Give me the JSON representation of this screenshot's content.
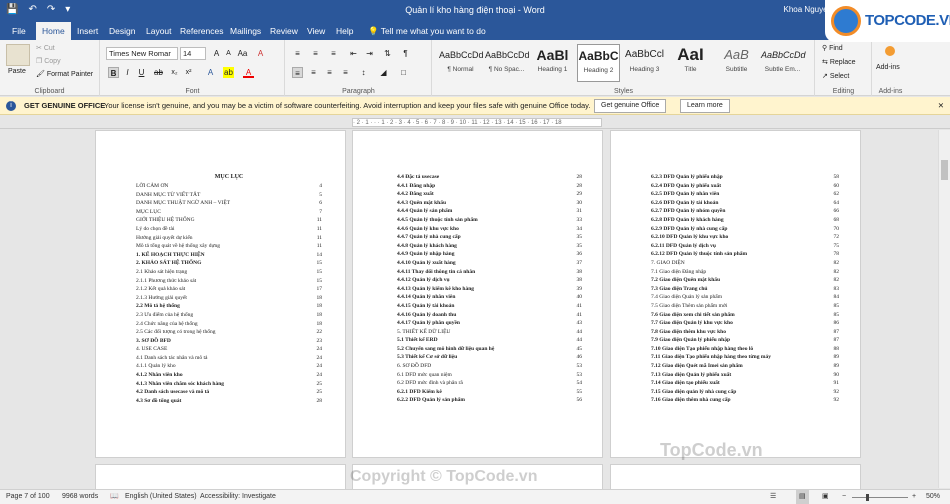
{
  "window": {
    "title": "Quản lí kho hàng điện thoại  -  Word",
    "user": "Khoa Nguyen"
  },
  "qat": {
    "save_icon": "save-icon",
    "undo_icon": "undo-icon",
    "redo_icon": "redo-icon"
  },
  "tabs": [
    "File",
    "Home",
    "Insert",
    "Design",
    "Layout",
    "References",
    "Mailings",
    "Review",
    "View",
    "Help"
  ],
  "tell_me": "Tell me what you want to do",
  "ribbon": {
    "clipboard": {
      "paste": "Paste",
      "cut": "Cut",
      "copy": "Copy",
      "format_painter": "Format Painter",
      "label": "Clipboard"
    },
    "font": {
      "name": "Times New Romar",
      "size": "14",
      "label": "Font"
    },
    "paragraph": {
      "label": "Paragraph"
    },
    "styles": {
      "label": "Styles",
      "items": [
        {
          "preview": "AaBbCcDd",
          "name": "¶ Normal"
        },
        {
          "preview": "AaBbCcDd",
          "name": "¶ No Spac..."
        },
        {
          "preview": "AaBl",
          "name": "Heading 1"
        },
        {
          "preview": "AaBbC",
          "name": "Heading 2"
        },
        {
          "preview": "AaBbCcl",
          "name": "Heading 3"
        },
        {
          "preview": "AaI",
          "name": "Title"
        },
        {
          "preview": "AaB",
          "name": "Subtitle"
        },
        {
          "preview": "AaBbCcDd",
          "name": "Subtle Em..."
        }
      ]
    },
    "editing": {
      "find": "Find",
      "replace": "Replace",
      "select": "Select",
      "label": "Editing"
    },
    "addins": {
      "addins": "Add-ins",
      "label": "Add-ins"
    }
  },
  "notice": {
    "title": "GET GENUINE OFFICE",
    "message": "Your license isn't genuine, and you may be a victim of software counterfeiting. Avoid interruption and keep your files safe with genuine Office today.",
    "btn_genuine": "Get genuine Office",
    "btn_learn": "Learn more"
  },
  "ruler_text": "· 2 · 1 · · · 1 · 2 · 3 · 4 · 5 · 6 · 7 · 8 · 9 · 10 · 11 · 12 · 13 · 14 · 15 · 16 · 17 · 18",
  "page1": {
    "heading": "MỤC LỤC",
    "rows": [
      {
        "t": "LỜI CẢM ƠN",
        "p": "4",
        "b": false
      },
      {
        "t": "DANH MỤC TỪ VIẾT TẮT",
        "p": "5",
        "b": false
      },
      {
        "t": "DANH MỤC THUẬT NGỮ ANH – VIỆT",
        "p": "6",
        "b": false
      },
      {
        "t": "MỤC LỤC",
        "p": "7",
        "b": false
      },
      {
        "t": "GIỚI THIỆU HỆ THỐNG",
        "p": "11",
        "b": false
      },
      {
        "t": "   Lý do chọn đề tài",
        "p": "11",
        "b": false
      },
      {
        "t": "   Hướng giải quyết dự kiến",
        "p": "11",
        "b": false
      },
      {
        "t": "   Mô tả tổng quát về hệ thống xây dựng",
        "p": "11",
        "b": false
      },
      {
        "t": "1.   KẾ HOẠCH THỰC HIỆN",
        "p": "14",
        "b": true
      },
      {
        "t": "2.   KHẢO SÁT HỆ THỐNG",
        "p": "15",
        "b": true
      },
      {
        "t": "   2.1   Khảo sát hiện trạng",
        "p": "15",
        "b": false
      },
      {
        "t": "      2.1.1 Phương thức khảo sát",
        "p": "15",
        "b": false
      },
      {
        "t": "      2.1.2 Kết quả khảo sát",
        "p": "17",
        "b": false
      },
      {
        "t": "      2.1.3 Hướng giải quyết",
        "p": "18",
        "b": false
      },
      {
        "t": "   2.2   Mô tả hệ thống",
        "p": "18",
        "b": true
      },
      {
        "t": "   2.3   Ưu điểm của hệ thống",
        "p": "18",
        "b": false
      },
      {
        "t": "   2.4   Chức năng của hệ thống",
        "p": "18",
        "b": false
      },
      {
        "t": "   2.5   Các đối tượng có trong hệ thống",
        "p": "22",
        "b": false
      },
      {
        "t": "3.   SƠ ĐỒ BFD",
        "p": "23",
        "b": true
      },
      {
        "t": "4.   USE CASE",
        "p": "24",
        "b": false
      },
      {
        "t": "   4.1   Danh sách tác nhân và mô tả",
        "p": "24",
        "b": false
      },
      {
        "t": "      4.1.1   Quản lý kho",
        "p": "24",
        "b": false
      },
      {
        "t": "         4.1.2   Nhân viên kho",
        "p": "24",
        "b": true
      },
      {
        "t": "         4.1.3   Nhân viên chăm sóc khách hàng",
        "p": "25",
        "b": true
      },
      {
        "t": "   4.2   Danh sách usecase và mô tả",
        "p": "25",
        "b": true
      },
      {
        "t": "   4.3   Sơ đồ tổng quát",
        "p": "28",
        "b": true
      }
    ]
  },
  "page2": {
    "rows": [
      {
        "t": "4.4   Đặc tả usecase",
        "p": "28",
        "b": true
      },
      {
        "t": "   4.4.1   Đăng nhập",
        "p": "28",
        "b": true
      },
      {
        "t": "   4.4.2   Đăng xuất",
        "p": "29",
        "b": true
      },
      {
        "t": "   4.4.3   Quên mật khẩu",
        "p": "30",
        "b": true
      },
      {
        "t": "   4.4.4   Quản lý sản phẩm",
        "p": "31",
        "b": true
      },
      {
        "t": "   4.4.5   Quản lý thuộc tính sản phẩm",
        "p": "33",
        "b": true
      },
      {
        "t": "   4.4.6   Quản lý khu vực kho",
        "p": "34",
        "b": true
      },
      {
        "t": "   4.4.7   Quản lý nhà cung cấp",
        "p": "35",
        "b": true
      },
      {
        "t": "   4.4.8   Quản lý khách hàng",
        "p": "35",
        "b": true
      },
      {
        "t": "   4.4.9   Quản lý nhập hàng",
        "p": "36",
        "b": true
      },
      {
        "t": "   4.4.10   Quản lý xuất hàng",
        "p": "37",
        "b": true
      },
      {
        "t": "   4.4.11   Thay đổi thông tin cá nhân",
        "p": "38",
        "b": true
      },
      {
        "t": "   4.4.12   Quản lý dịch vụ",
        "p": "38",
        "b": true
      },
      {
        "t": "   4.4.13   Quản lý kiểm kê kho hàng",
        "p": "39",
        "b": true
      },
      {
        "t": "   4.4.14   Quản lý nhân viên",
        "p": "40",
        "b": true
      },
      {
        "t": "   4.4.15   Quản lý tài khoản",
        "p": "41",
        "b": true
      },
      {
        "t": "   4.4.16   Quản lý doanh thu",
        "p": "41",
        "b": true
      },
      {
        "t": "   4.4.17   Quản lý phân quyền",
        "p": "43",
        "b": true
      },
      {
        "t": "5. THIẾT KẾ DỮ LIỆU",
        "p": "44",
        "b": false
      },
      {
        "t": "   5.1   Thiết kế ERD",
        "p": "44",
        "b": true
      },
      {
        "t": "   5.2   Chuyển sang mô hình dữ liệu quan hệ",
        "p": "45",
        "b": true
      },
      {
        "t": "   5.3   Thiết kế Cơ sở dữ liệu",
        "p": "46",
        "b": true
      },
      {
        "t": "6. SƠ ĐỒ DFD",
        "p": "53",
        "b": false
      },
      {
        "t": "   6.1 DFD mức quan niệm",
        "p": "53",
        "b": false
      },
      {
        "t": "   6.2 DFD mức đỉnh và phân rã",
        "p": "54",
        "b": false
      },
      {
        "t": "      6.2.1   DFD Kiểm kê",
        "p": "55",
        "b": true
      },
      {
        "t": "      6.2.2   DFD Quản lý sản phẩm",
        "p": "56",
        "b": true
      }
    ]
  },
  "page3": {
    "rows": [
      {
        "t": "   6.2.3   DFD Quản lý phiếu nhập",
        "p": "58",
        "b": true
      },
      {
        "t": "   6.2.4   DFD Quản lý phiếu xuất",
        "p": "60",
        "b": true
      },
      {
        "t": "   6.2.5   DFD Quản lý nhân viên",
        "p": "62",
        "b": true
      },
      {
        "t": "   6.2.6   DFD Quản lý tài khoản",
        "p": "64",
        "b": true
      },
      {
        "t": "   6.2.7   DFD Quản lý nhóm quyền",
        "p": "66",
        "b": true
      },
      {
        "t": "   6.2.8   DFD Quản lý khách hàng",
        "p": "68",
        "b": true
      },
      {
        "t": "   6.2.9   DFD Quản lý nhà cung cấp",
        "p": "70",
        "b": true
      },
      {
        "t": "   6.2.10   DFD Quản lý khu vực kho",
        "p": "72",
        "b": true
      },
      {
        "t": "   6.2.11   DFD Quản lý dịch vụ",
        "p": "75",
        "b": true
      },
      {
        "t": "   6.2.12   DFD Quản lý thuộc tính sản phẩm",
        "p": "78",
        "b": true
      },
      {
        "t": "7. GIAO DIỆN",
        "p": "82",
        "b": false
      },
      {
        "t": "   7.1   Giao diện Đăng nhập",
        "p": "82",
        "b": false
      },
      {
        "t": "   7.2   Giao diện Quên mật khẩu",
        "p": "82",
        "b": true
      },
      {
        "t": "   7.3   Giao diện Trang chủ",
        "p": "83",
        "b": true
      },
      {
        "t": "   7.4   Giao diện Quản lý sản phẩm",
        "p": "84",
        "b": false
      },
      {
        "t": "   7.5   Giao diện Thêm sản phẩm mới",
        "p": "85",
        "b": false
      },
      {
        "t": "   7.6   Giao diện xem chi tiết sản phẩm",
        "p": "85",
        "b": true
      },
      {
        "t": "   7.7   Giao diện Quản lý khu vực kho",
        "p": "86",
        "b": true
      },
      {
        "t": "   7.8   Giao diện thêm khu vực kho",
        "p": "87",
        "b": true
      },
      {
        "t": "   7.9   Giao diện Quản lý phiếu nhập",
        "p": "87",
        "b": true
      },
      {
        "t": "   7.10   Giao diện Tạo phiếu nhập hàng theo lô",
        "p": "88",
        "b": true
      },
      {
        "t": "   7.11   Giao diện Tạo phiếu nhập hàng theo từng máy",
        "p": "89",
        "b": true
      },
      {
        "t": "   7.12   Giao diện Quét mã Imei sản phẩm",
        "p": "89",
        "b": true
      },
      {
        "t": "   7.13   Giao diện Quản lý phiếu xuất",
        "p": "90",
        "b": true
      },
      {
        "t": "   7.14   Giao diện tạo phiếu xuất",
        "p": "91",
        "b": true
      },
      {
        "t": "   7.15   Giao diện quản lý nhà cung cấp",
        "p": "92",
        "b": true
      },
      {
        "t": "   7.16   Giao diện thêm nhà cung cấp",
        "p": "92",
        "b": true
      }
    ]
  },
  "status": {
    "page": "Page 7 of 100",
    "words": "9968 words",
    "language": "English (United States)",
    "accessibility": "Accessibility: Investigate",
    "zoom": "50%"
  },
  "watermarks": {
    "logo": "TOPCODE.VN",
    "center": "Copyright © TopCode.vn",
    "right": "TopCode.vn"
  }
}
